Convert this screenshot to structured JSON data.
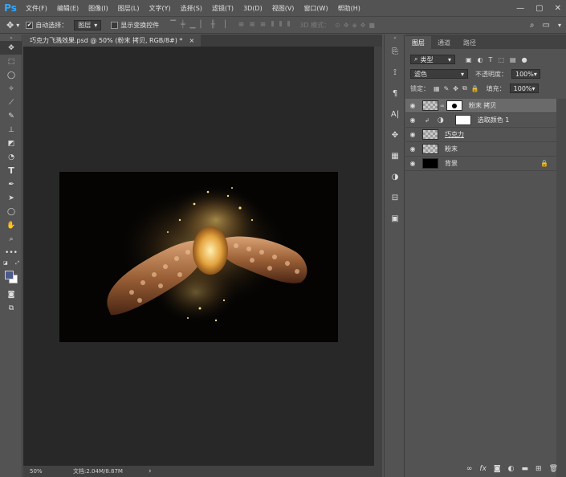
{
  "app": {
    "logo": "Ps"
  },
  "menu": [
    "文件(F)",
    "编辑(E)",
    "图像(I)",
    "图层(L)",
    "文字(Y)",
    "选择(S)",
    "滤镜(T)",
    "3D(D)",
    "视图(V)",
    "窗口(W)",
    "帮助(H)"
  ],
  "options": {
    "auto_select_label": "自动选择：",
    "auto_select_value": "图层",
    "show_transform_label": "显示变换控件",
    "mode_3d_label": "3D 模式："
  },
  "document": {
    "tab_title": "巧克力飞溅效果.psd @ 50% (粉末 拷贝, RGB/8#) *",
    "close": "×",
    "zoom": "50%",
    "doc_info": "文档:2.04M/8.87M",
    "status_arrow": "›"
  },
  "panel": {
    "tabs": [
      "图层",
      "通道",
      "路径"
    ],
    "filter_kind": "类型",
    "blend_mode": "滤色",
    "opacity_label": "不透明度：",
    "opacity_value": "100%",
    "lock_label": "锁定：",
    "fill_label": "填充：",
    "fill_value": "100%"
  },
  "layers": [
    {
      "name": "粉末 拷贝",
      "selected": true
    },
    {
      "name": "选取颜色 1",
      "selected": false
    },
    {
      "name": "巧克力",
      "selected": false
    },
    {
      "name": "粉末",
      "selected": false
    },
    {
      "name": "背景",
      "selected": false
    }
  ],
  "colors": {
    "foreground": "#4d5a8c",
    "background": "#ffffff",
    "accent": "#31a8ff"
  }
}
